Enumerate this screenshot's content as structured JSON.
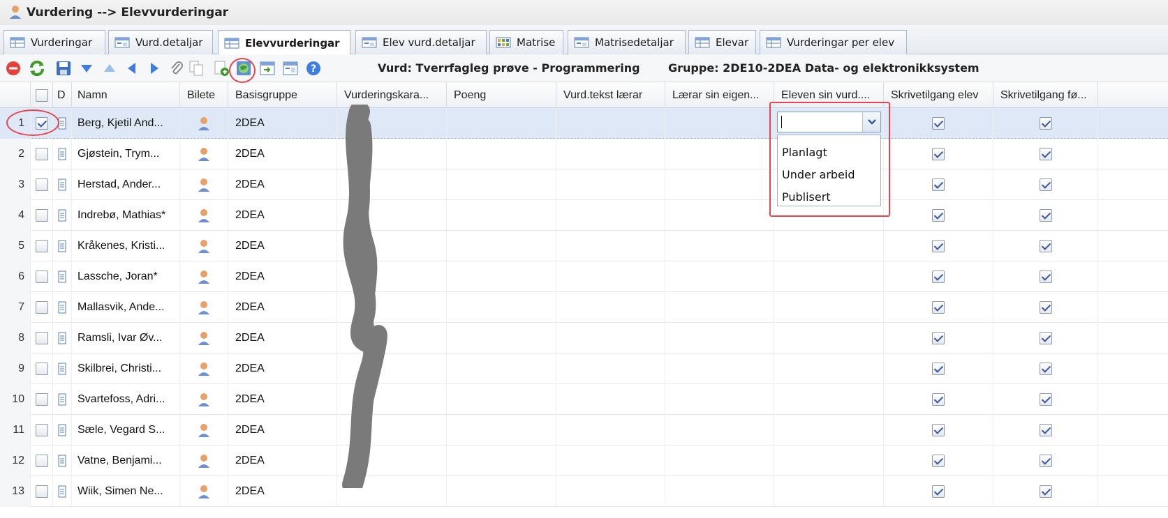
{
  "window": {
    "title": "Vurdering --> Elevvurderingar"
  },
  "tabs": [
    {
      "label": "Vurderingar",
      "active": false
    },
    {
      "label": "Vurd.detaljar",
      "active": false
    },
    {
      "label": "Elevvurderingar",
      "active": true
    },
    {
      "label": "Elev vurd.detaljar",
      "active": false
    },
    {
      "label": "Matrise",
      "active": false
    },
    {
      "label": "Matrisedetaljar",
      "active": false
    },
    {
      "label": "Elevar",
      "active": false
    },
    {
      "label": "Vurderingar per elev",
      "active": false
    }
  ],
  "toolbar": {
    "vurd_info": "Vurd: Tverrfagleg prøve - Programmering",
    "gruppe_info": "Gruppe: 2DE10-2DEA Data- og elektronikksystem"
  },
  "grid": {
    "columns": {
      "d": "D",
      "namn": "Namn",
      "bilete": "Bilete",
      "basisgruppe": "Basisgruppe",
      "vurderingskarakter": "Vurderingskara...",
      "poeng": "Poeng",
      "vurd_tekst": "Vurd.tekst lærar",
      "laerar_eigen": "Lærar sin eigen...",
      "eleven_vurd": "Eleven sin vurd....",
      "skrivetilgang_elev": "Skrivetilgang elev",
      "skrivetilgang_fo": "Skrivetilgang fø..."
    },
    "rows": [
      {
        "num": "1",
        "name": "Berg, Kjetil And...",
        "group": "2DEA",
        "selected": true
      },
      {
        "num": "2",
        "name": "Gjøstein, Trym...",
        "group": "2DEA",
        "selected": false
      },
      {
        "num": "3",
        "name": "Herstad, Ander...",
        "group": "2DEA",
        "selected": false
      },
      {
        "num": "4",
        "name": "Indrebø, Mathias*",
        "group": "2DEA",
        "selected": false
      },
      {
        "num": "5",
        "name": "Kråkenes, Kristi...",
        "group": "2DEA",
        "selected": false
      },
      {
        "num": "6",
        "name": "Lassche, Joran*",
        "group": "2DEA",
        "selected": false
      },
      {
        "num": "7",
        "name": "Mallasvik, Ande...",
        "group": "2DEA",
        "selected": false
      },
      {
        "num": "8",
        "name": "Ramsli, Ivar Øv...",
        "group": "2DEA",
        "selected": false
      },
      {
        "num": "9",
        "name": "Skilbrei, Christi...",
        "group": "2DEA",
        "selected": false
      },
      {
        "num": "10",
        "name": "Svartefoss, Adri...",
        "group": "2DEA",
        "selected": false
      },
      {
        "num": "11",
        "name": "Sæle, Vegard S...",
        "group": "2DEA",
        "selected": false
      },
      {
        "num": "12",
        "name": "Vatne, Benjami...",
        "group": "2DEA",
        "selected": false
      },
      {
        "num": "13",
        "name": "Wiik, Simen Ne...",
        "group": "2DEA",
        "selected": false
      }
    ]
  },
  "dropdown": {
    "current_value": "",
    "options": [
      "Planlagt",
      "Under arbeid",
      "Publisert"
    ]
  },
  "colors": {
    "annotation": "#e8434f",
    "selection": "#dfe8f6",
    "redaction": "#7a7a7a"
  }
}
